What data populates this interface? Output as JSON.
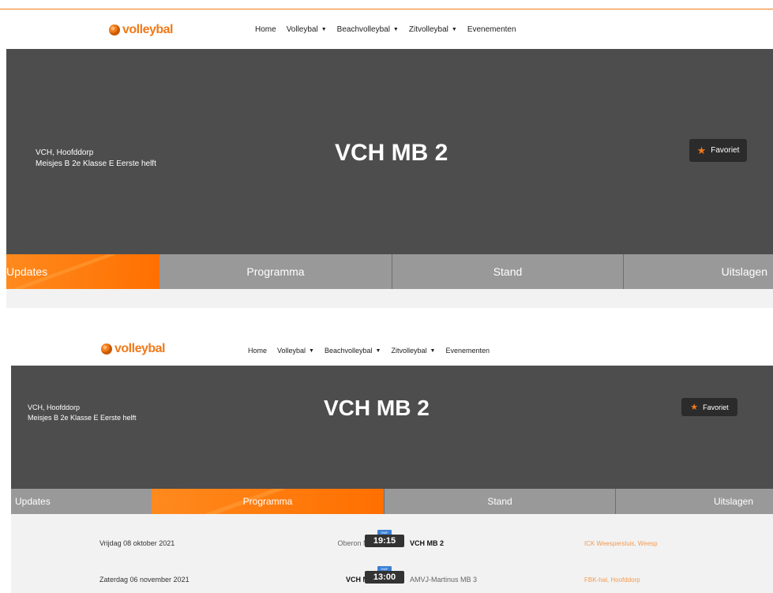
{
  "brand": {
    "name": "volleybal",
    "accent": "#f07a1a"
  },
  "nav": {
    "items": [
      {
        "label": "Home",
        "dropdown": false
      },
      {
        "label": "Volleybal",
        "dropdown": true
      },
      {
        "label": "Beachvolleybal",
        "dropdown": true
      },
      {
        "label": "Zitvolleybal",
        "dropdown": true
      },
      {
        "label": "Evenementen",
        "dropdown": false
      }
    ]
  },
  "team": {
    "club": "VCH, Hoofddorp",
    "league": "Meisjes B 2e Klasse E Eerste helft",
    "title": "VCH MB 2",
    "favorite_label": "Favoriet"
  },
  "tabs": [
    "Updates",
    "Programma",
    "Stand",
    "Uitslagen"
  ],
  "screen1": {
    "active_tab": "Updates"
  },
  "screen2": {
    "active_tab": "Programma"
  },
  "matches": [
    {
      "date": "Vrijdag 08 oktober 2021",
      "home": "Oberon MB 1",
      "time": "19:15",
      "badge": "DWF",
      "away": "VCH MB 2",
      "venue": "ICK Weespersluis, Weesp",
      "home_is_team": false
    },
    {
      "date": "Zaterdag 06 november 2021",
      "home": "VCH MB 2",
      "time": "13:00",
      "badge": "DWF",
      "away": "AMVJ-Martinus MB 3",
      "venue": "FBK-hal, Hoofddorp",
      "home_is_team": true
    }
  ]
}
